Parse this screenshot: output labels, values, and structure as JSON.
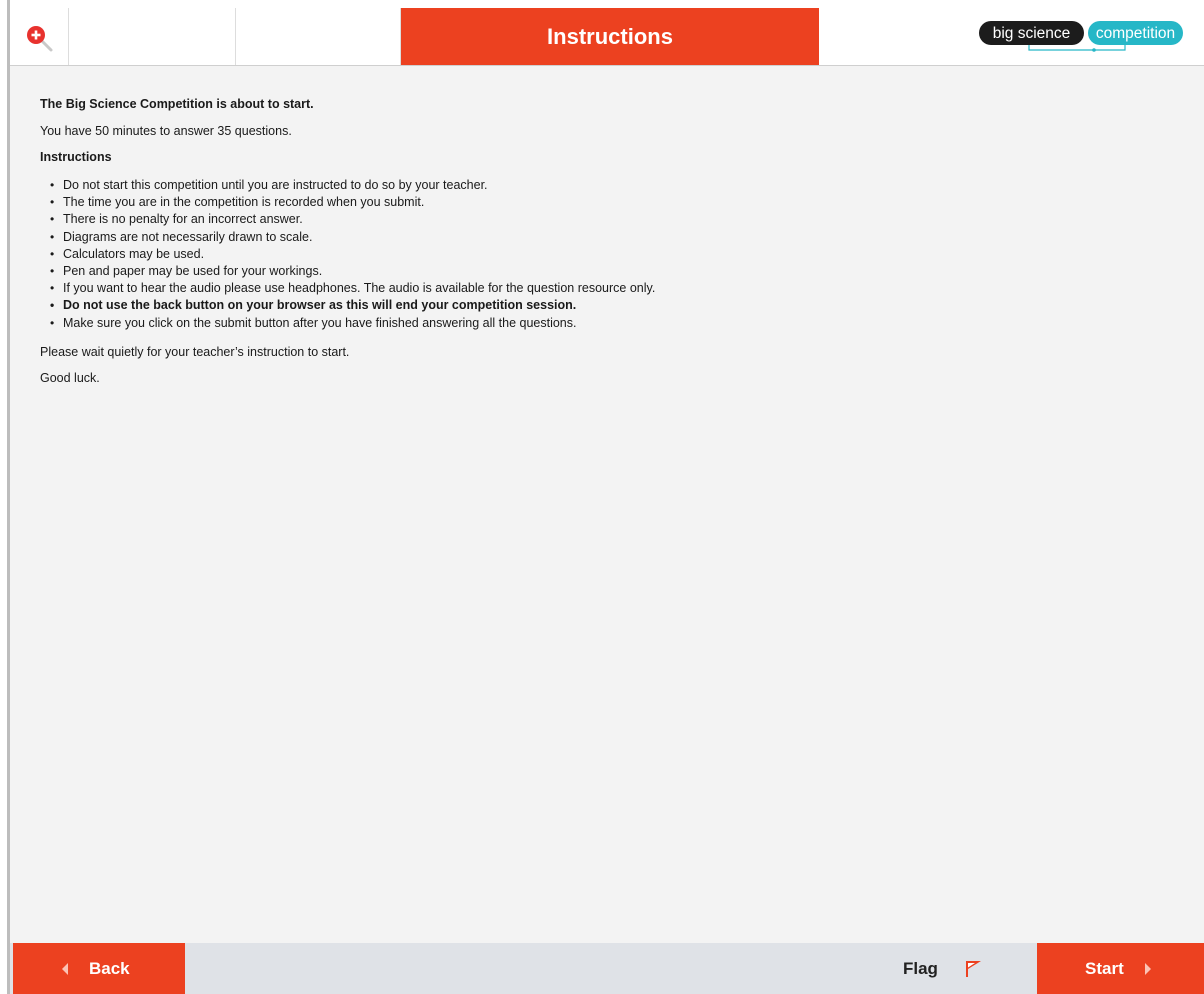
{
  "header": {
    "title": "Instructions",
    "logo_left": "big science",
    "logo_right": "competition",
    "logo_left_color": "#1c1c1c",
    "logo_right_color": "#26b7c7"
  },
  "content": {
    "lead": "The Big Science Competition is about to start.",
    "duration": "You have 50 minutes to answer 35 questions.",
    "instructions_heading": "Instructions",
    "instructions": [
      "Do not start this competition until you are instructed to do so by your teacher.",
      "The time you are in the competition is recorded when you submit.",
      "There is no penalty for an incorrect answer.",
      "Diagrams are not necessarily drawn to scale.",
      "Calculators may be used.",
      "Pen and paper may be used for your workings.",
      "If you want to hear the audio please use headphones. The audio is available for the question resource only.",
      "Do not use the back button on your browser as this will end your competition session.",
      "Make sure you click on the submit button after you have finished answering all the questions."
    ],
    "wait": "Please wait quietly for your teacher’s instruction to start.",
    "closing": "Good luck."
  },
  "footer": {
    "back_label": "Back",
    "flag_label": "Flag",
    "start_label": "Start"
  },
  "colors": {
    "accent": "#ec4120",
    "footer_bg": "#dfe2e7",
    "page_bg": "#f3f3f3"
  },
  "icons": {
    "zoom": "zoom-in-icon",
    "flag": "flag-icon",
    "back": "chevron-left-icon",
    "start": "chevron-right-icon"
  }
}
